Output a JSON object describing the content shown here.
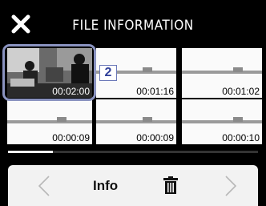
{
  "header": {
    "title": "FILE INFORMATION",
    "close_icon": "close-icon"
  },
  "files": [
    {
      "time": "00:02:00",
      "selected": true
    },
    {
      "time": "00:01:16",
      "selected": false
    },
    {
      "time": "00:01:02",
      "selected": false
    },
    {
      "time": "00:00:09",
      "selected": false
    },
    {
      "time": "00:00:09",
      "selected": false
    },
    {
      "time": "00:00:10",
      "selected": false
    }
  ],
  "selected_badge": "2",
  "scroll": {
    "position_fraction": 0.18
  },
  "toolbar": {
    "prev_icon": "chevron-left-icon",
    "info_label": "Info",
    "trash_icon": "trash-icon",
    "next_icon": "chevron-right-icon"
  },
  "colors": {
    "selection": "#8a93c0",
    "badge_text": "#2f3f9a",
    "background": "#000000"
  }
}
